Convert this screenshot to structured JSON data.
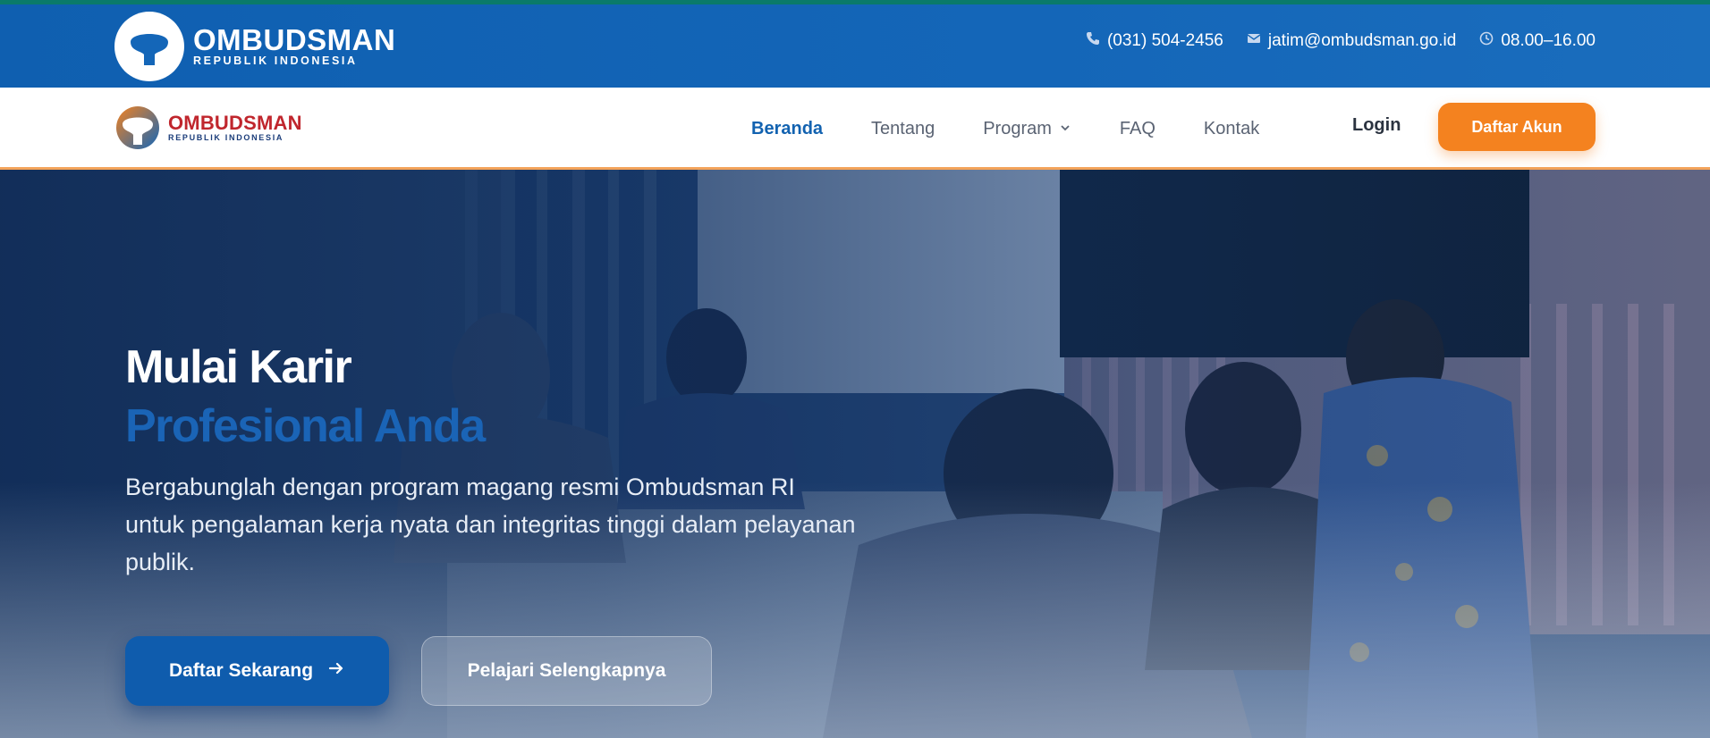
{
  "brand": {
    "name": "OMBUDSMAN",
    "subtitle": "REPUBLIK INDONESIA"
  },
  "topbar": {
    "phone": "(031) 504-2456",
    "email": "jatim@ombudsman.go.id",
    "hours": "08.00–16.00"
  },
  "nav": {
    "items": [
      {
        "label": "Beranda",
        "active": true
      },
      {
        "label": "Tentang"
      },
      {
        "label": "Program",
        "dropdown": true
      },
      {
        "label": "FAQ"
      },
      {
        "label": "Kontak"
      }
    ],
    "login": "Login",
    "signup": "Daftar Akun"
  },
  "hero": {
    "title_line1": "Mulai Karir",
    "title_line2": "Profesional Anda",
    "lead": "Bergabunglah dengan program magang resmi Ombudsman RI untuk pengalaman kerja nyata dan integritas tinggi dalam pelayanan publik.",
    "primary_cta": "Daftar Sekarang",
    "secondary_cta": "Pelajari Selengkapnya"
  },
  "colors": {
    "primary": "#1262b0",
    "accent": "#f4821f",
    "topbar": "#1466b8"
  }
}
